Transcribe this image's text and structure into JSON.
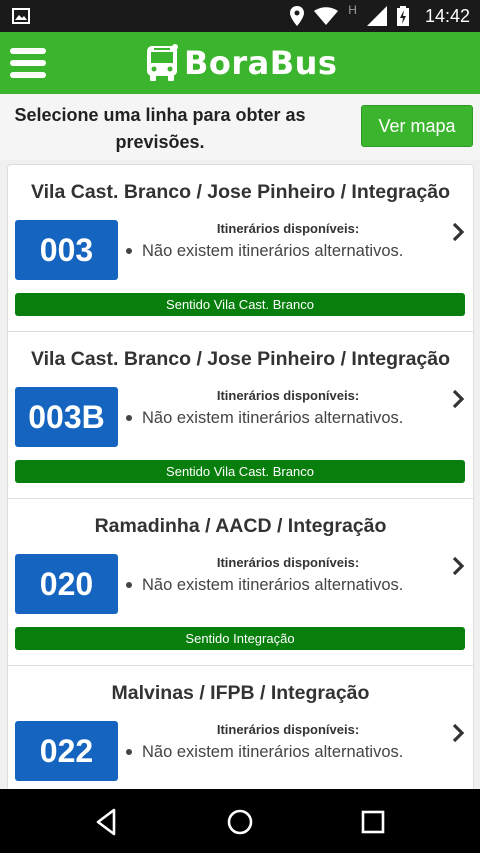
{
  "status_bar": {
    "time": "14:42",
    "network_letter": "H",
    "icons": [
      "image-notification-icon",
      "location-icon",
      "wifi-icon",
      "signal-icon",
      "battery-charging-icon"
    ]
  },
  "app_bar": {
    "brand_name": "BoraBus",
    "brand_icon": "bus-icon",
    "menu_icon": "hamburger-icon",
    "color": "#3cb52e"
  },
  "header": {
    "instructions": "Selecione uma linha para obter as previsões.",
    "map_button_label": "Ver mapa"
  },
  "routes": [
    {
      "title": "Vila Cast. Branco / Jose Pinheiro / Integração",
      "number": "003",
      "itinerary_heading": "Itinerários disponíveis:",
      "itinerary_item": "Não existem itinerários alternativos.",
      "direction": "Sentido Vila Cast. Branco"
    },
    {
      "title": "Vila Cast. Branco / Jose Pinheiro / Integração",
      "number": "003B",
      "itinerary_heading": "Itinerários disponíveis:",
      "itinerary_item": "Não existem itinerários alternativos.",
      "direction": "Sentido Vila Cast. Branco"
    },
    {
      "title": "Ramadinha / AACD / Integração",
      "number": "020",
      "itinerary_heading": "Itinerários disponíveis:",
      "itinerary_item": "Não existem itinerários alternativos.",
      "direction": "Sentido Integração"
    },
    {
      "title": "Malvinas / IFPB / Integração",
      "number": "022",
      "itinerary_heading": "Itinerários disponíveis:",
      "itinerary_item": "Não existem itinerários alternativos.",
      "direction": ""
    }
  ],
  "colors": {
    "accent_green": "#3cb52e",
    "direction_green": "#087f0d",
    "route_blue": "#1565c0"
  },
  "nav_bar": {
    "icons": [
      "back-icon",
      "home-icon",
      "recents-icon"
    ]
  }
}
